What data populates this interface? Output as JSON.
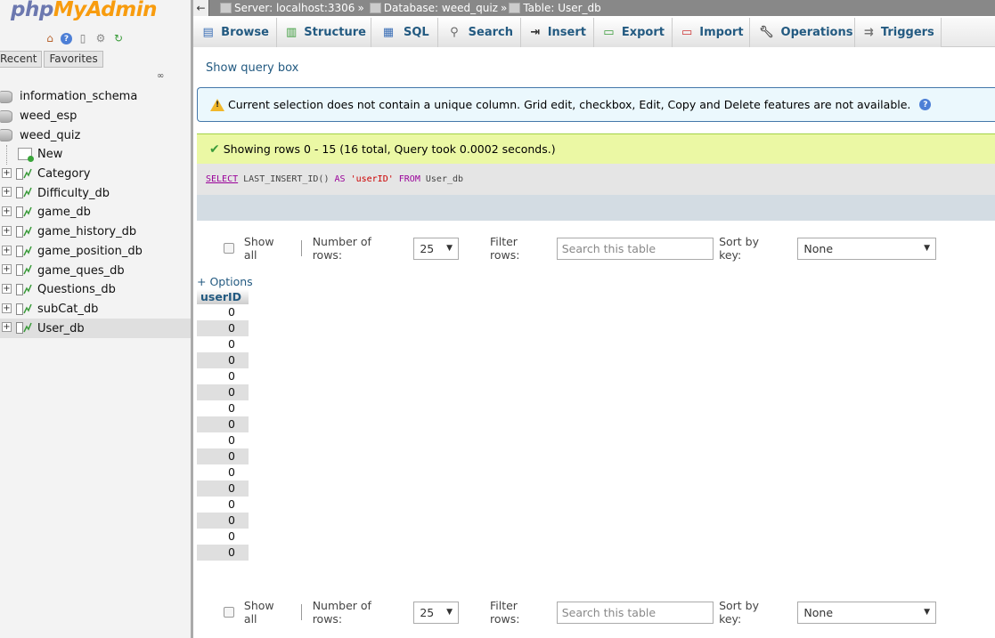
{
  "sidebar": {
    "logo_php": "php",
    "logo_myadmin": "MyAdmin",
    "quick_icons": [
      "home-icon",
      "help-icon",
      "docs-icon",
      "settings-icon",
      "reload-icon"
    ],
    "tabs": [
      "Recent",
      "Favorites"
    ],
    "databases": [
      {
        "name": "information_schema"
      },
      {
        "name": "weed_esp"
      },
      {
        "name": "weed_quiz"
      }
    ],
    "new_label": "New",
    "tables": [
      "Category",
      "Difficulty_db",
      "game_db",
      "game_history_db",
      "game_position_db",
      "game_ques_db",
      "Questions_db",
      "subCat_db",
      "User_db"
    ],
    "selected_table": "User_db"
  },
  "breadcrumb": {
    "server": "Server: localhost:3306",
    "database": "Database: weed_quiz",
    "table": "Table: User_db",
    "separator": "»"
  },
  "menu": [
    "Browse",
    "Structure",
    "SQL",
    "Search",
    "Insert",
    "Export",
    "Import",
    "Operations",
    "Triggers"
  ],
  "show_query_box": "Show query box",
  "notice": "Current selection does not contain a unique column. Grid edit, checkbox, Edit, Copy and Delete features are not available.",
  "success": "Showing rows 0 - 15 (16 total, Query took 0.0002 seconds.)",
  "sql": {
    "select": "SELECT",
    "expr": " LAST_INSERT_ID() ",
    "as": "AS",
    "alias": " 'userID' ",
    "from": "FROM",
    "table": " User_db"
  },
  "nav": {
    "show_all": "Show all",
    "number_of_rows_label": "Number of rows:",
    "number_of_rows": "25",
    "filter_label": "Filter rows:",
    "filter_placeholder": "Search this table",
    "sort_label": "Sort by key:",
    "sort_value": "None"
  },
  "options_link": "+ Options",
  "table": {
    "column": "userID",
    "rows": [
      "0",
      "0",
      "0",
      "0",
      "0",
      "0",
      "0",
      "0",
      "0",
      "0",
      "0",
      "0",
      "0",
      "0",
      "0",
      "0"
    ]
  }
}
